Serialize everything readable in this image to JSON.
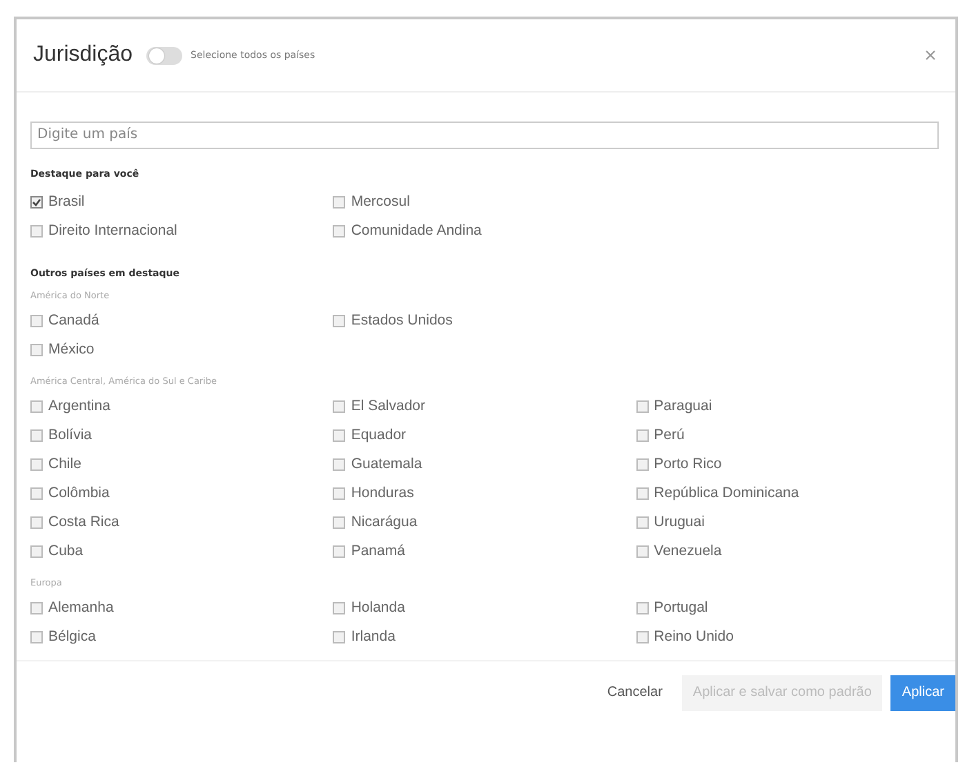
{
  "dialog": {
    "title": "Jurisdição",
    "select_all": {
      "label": "Selecione todos os países",
      "on": false
    }
  },
  "search": {
    "placeholder": "Digite um país"
  },
  "sections": [
    {
      "title": "Destaque para você",
      "groups": [
        {
          "columns": [
            [
              {
                "label": "Brasil",
                "checked": true
              },
              {
                "label": "Direito Internacional",
                "checked": false
              }
            ],
            [
              {
                "label": "Mercosul",
                "checked": false
              },
              {
                "label": "Comunidade Andina",
                "checked": false
              }
            ]
          ]
        }
      ]
    },
    {
      "title": "Outros países em destaque",
      "groups": [
        {
          "title": "América do Norte",
          "columns": [
            [
              {
                "label": "Canadá",
                "checked": false
              },
              {
                "label": "México",
                "checked": false
              }
            ],
            [
              {
                "label": "Estados Unidos",
                "checked": false
              }
            ]
          ]
        },
        {
          "title": "América Central, América do Sul e Caribe",
          "columns": [
            [
              {
                "label": "Argentina",
                "checked": false
              },
              {
                "label": "Bolívia",
                "checked": false
              },
              {
                "label": "Chile",
                "checked": false
              },
              {
                "label": "Colômbia",
                "checked": false
              },
              {
                "label": "Costa Rica",
                "checked": false
              },
              {
                "label": "Cuba",
                "checked": false
              }
            ],
            [
              {
                "label": "El Salvador",
                "checked": false
              },
              {
                "label": "Equador",
                "checked": false
              },
              {
                "label": "Guatemala",
                "checked": false
              },
              {
                "label": "Honduras",
                "checked": false
              },
              {
                "label": "Nicarágua",
                "checked": false
              },
              {
                "label": "Panamá",
                "checked": false
              }
            ],
            [
              {
                "label": "Paraguai",
                "checked": false
              },
              {
                "label": "Perú",
                "checked": false
              },
              {
                "label": "Porto Rico",
                "checked": false
              },
              {
                "label": "República Dominicana",
                "checked": false
              },
              {
                "label": "Uruguai",
                "checked": false
              },
              {
                "label": "Venezuela",
                "checked": false
              }
            ]
          ]
        },
        {
          "title": "Europa",
          "columns": [
            [
              {
                "label": "Alemanha",
                "checked": false
              },
              {
                "label": "Bélgica",
                "checked": false
              }
            ],
            [
              {
                "label": "Holanda",
                "checked": false
              },
              {
                "label": "Irlanda",
                "checked": false
              }
            ],
            [
              {
                "label": "Portugal",
                "checked": false
              },
              {
                "label": "Reino Unido",
                "checked": false
              }
            ]
          ]
        }
      ]
    }
  ],
  "footer": {
    "buttons": [
      {
        "label": "Cancelar",
        "kind": "link",
        "disabled": false
      },
      {
        "label": "Aplicar e salvar como padrão",
        "kind": "secondary",
        "disabled": true
      },
      {
        "label": "Aplicar",
        "kind": "primary",
        "disabled": false
      }
    ]
  }
}
